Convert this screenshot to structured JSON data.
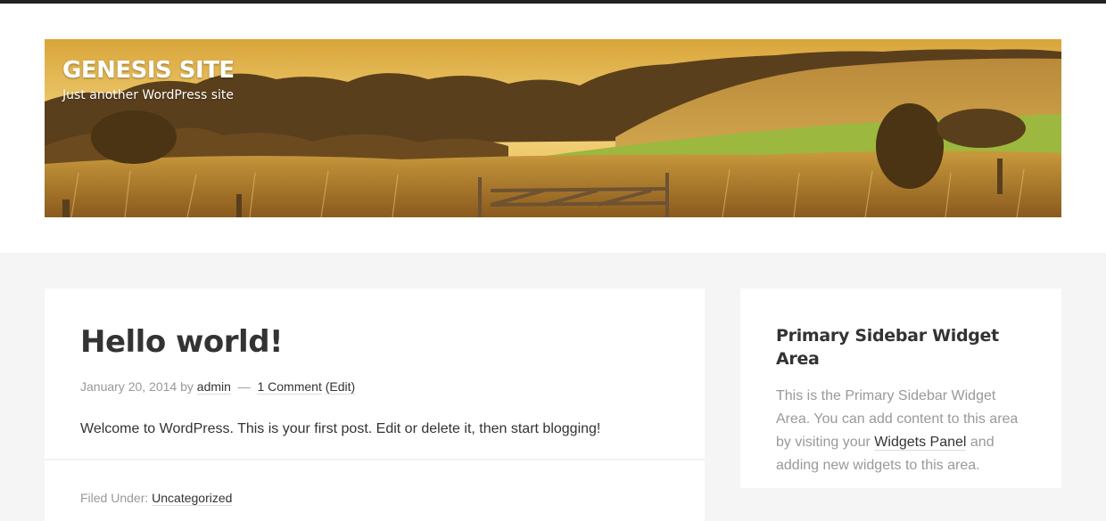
{
  "header": {
    "site_title": "GENESIS SITE",
    "site_description": "Just another WordPress site",
    "image": "golden-countryside-landscape"
  },
  "post": {
    "title": "Hello world!",
    "meta": {
      "date": "January 20, 2014",
      "by": "by",
      "author": "admin",
      "separator": "—",
      "comments": "1 Comment",
      "edit": "(Edit)"
    },
    "content": "Welcome to WordPress. This is your first post. Edit or delete it, then start blogging!",
    "footer": {
      "filed_under": "Filed Under:",
      "category": "Uncategorized"
    }
  },
  "sidebar": {
    "widget_title": "Primary Sidebar Widget Area",
    "text_before": "This is the Primary Sidebar Widget Area. You can add content to this area by visiting your",
    "link": "Widgets Panel",
    "text_after": "and adding new widgets to this area."
  },
  "colors": {
    "top_bar": "#222222",
    "page_background": "#f5f5f5",
    "text": "#333333",
    "muted_text": "#999999"
  }
}
